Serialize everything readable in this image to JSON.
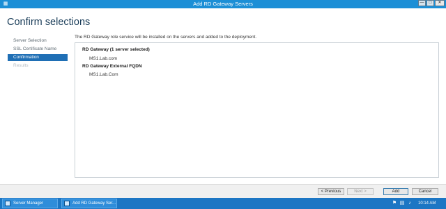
{
  "window": {
    "title": "Add RD Gateway Servers",
    "buttons": {
      "minimize": "—",
      "maximize": "□",
      "close": "✕"
    }
  },
  "page": {
    "title": "Confirm selections",
    "description": "The RD Gateway role service will be installed on the servers and added to the deployment."
  },
  "nav": {
    "items": [
      {
        "label": "Server Selection",
        "state": "normal"
      },
      {
        "label": "SSL Certificate Name",
        "state": "normal"
      },
      {
        "label": "Confirmation",
        "state": "active"
      },
      {
        "label": "Results",
        "state": "disabled"
      }
    ]
  },
  "content": {
    "sections": [
      {
        "title": "RD Gateway  (1 server selected)",
        "value": "MS1.Lab.com"
      },
      {
        "title": "RD Gateway External FQDN",
        "value": "MS1.Lab.Com"
      }
    ]
  },
  "footer": {
    "previous": "< Previous",
    "next": "Next >",
    "add": "Add",
    "cancel": "Cancel"
  },
  "taskbar": {
    "items": [
      {
        "label": "Server Manager"
      },
      {
        "label": "Add RD Gateway Ser..."
      }
    ],
    "clock": "10:14 AM"
  },
  "colors": {
    "titlebar": "#1c8fd6",
    "nav_active": "#1f6fb5",
    "taskbar": "#1c76c4",
    "title_text": "#1a3d59"
  },
  "icons": [
    "server-manager-icon",
    "flag-icon",
    "network-icon",
    "speaker-icon"
  ]
}
